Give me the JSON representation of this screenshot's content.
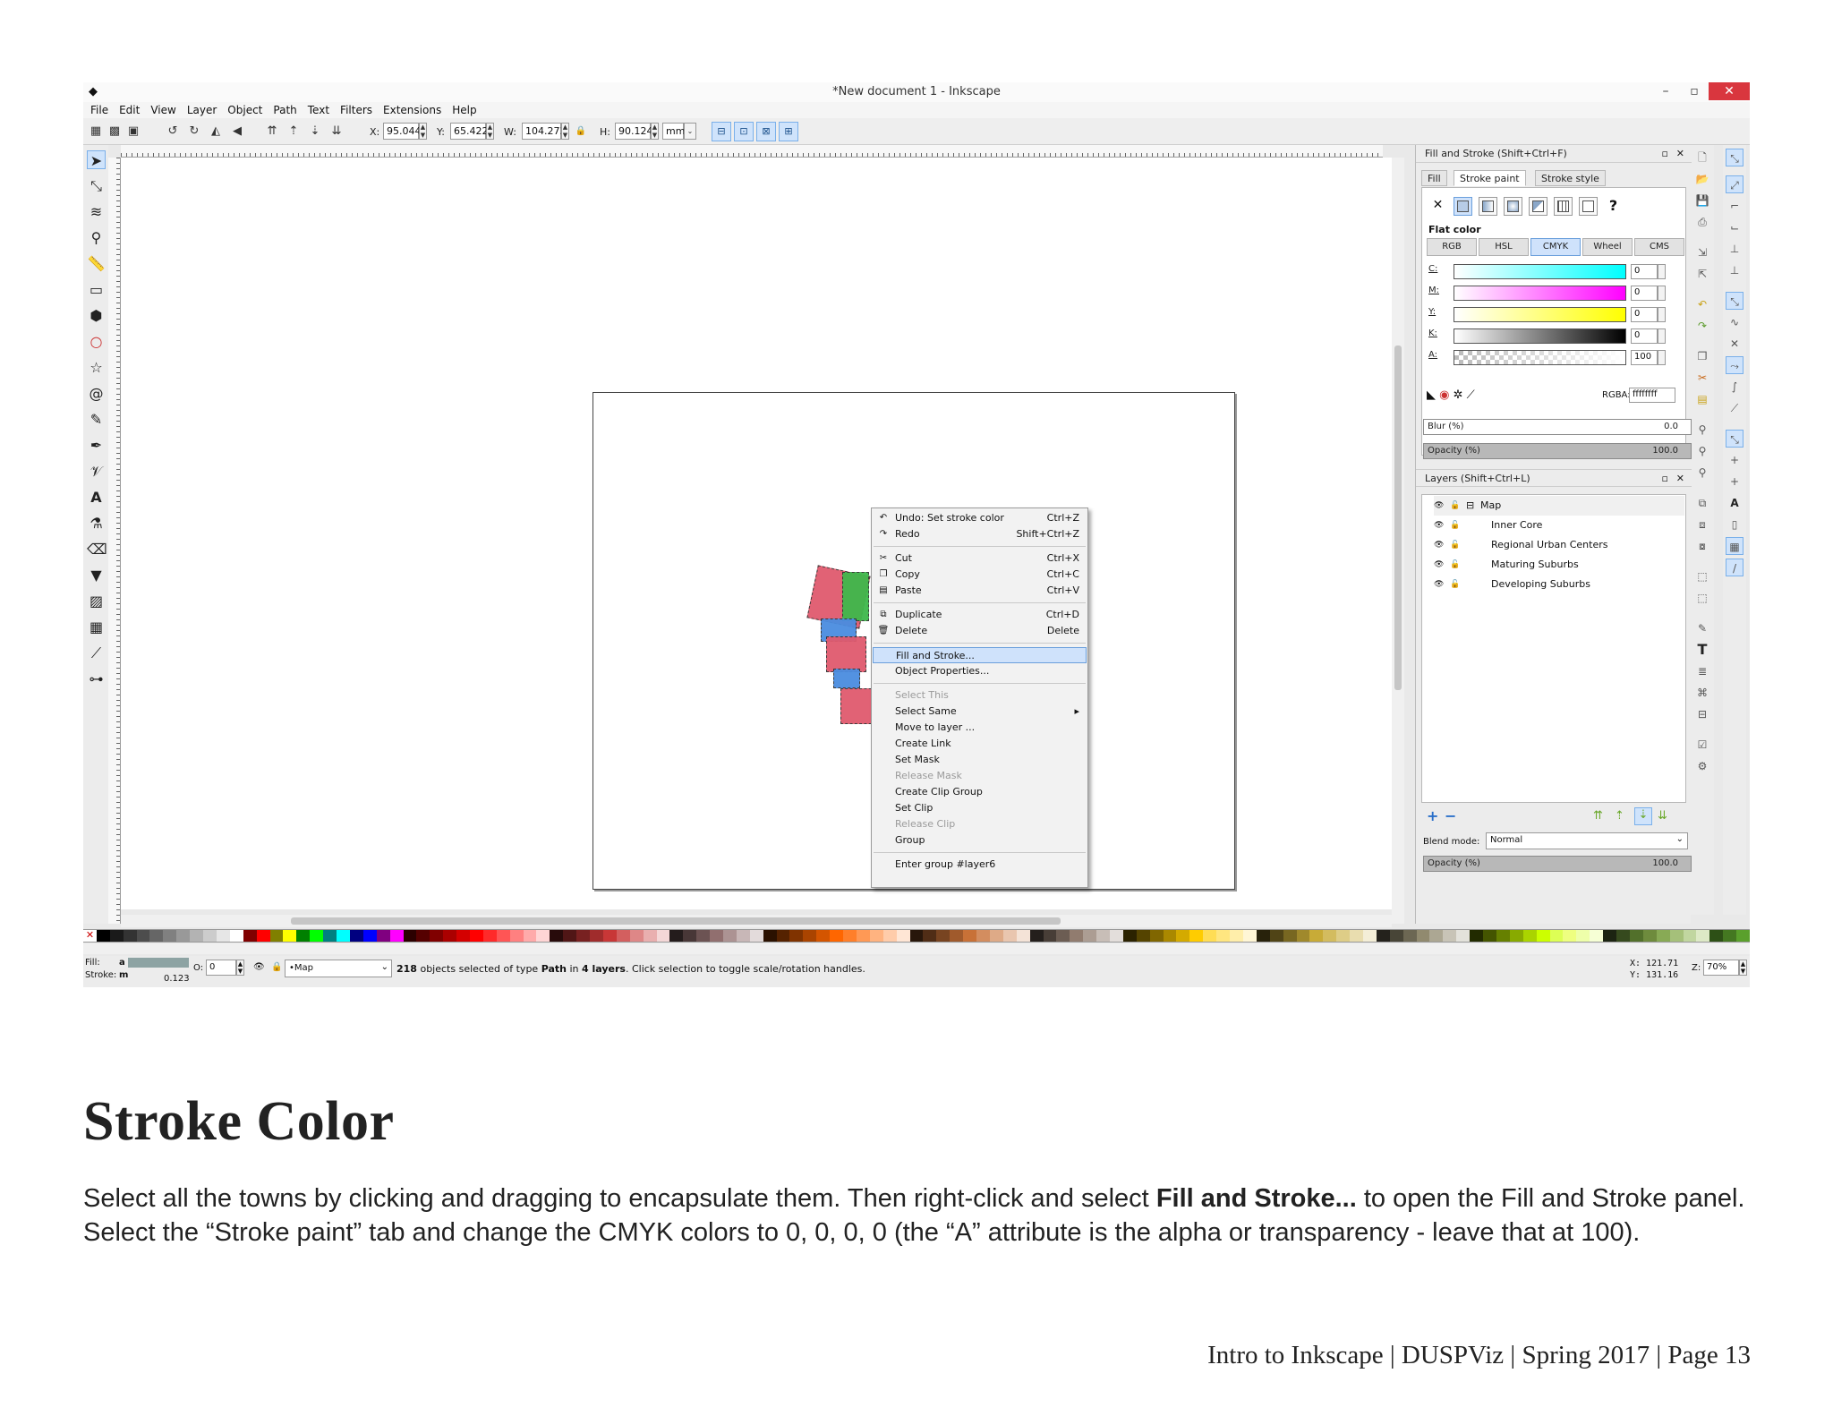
{
  "window": {
    "title": "*New document 1 - Inkscape",
    "minimize": "–",
    "restore": "▫",
    "close": "✕"
  },
  "menubar": [
    "File",
    "Edit",
    "View",
    "Layer",
    "Object",
    "Path",
    "Text",
    "Filters",
    "Extensions",
    "Help"
  ],
  "toolbar": {
    "x_label": "X:",
    "x_value": "95.044",
    "y_label": "Y:",
    "y_value": "65.422",
    "w_label": "W:",
    "w_value": "104.273",
    "h_label": "H:",
    "h_value": "90.124",
    "unit": "mm"
  },
  "context_menu": [
    {
      "label": "Undo: Set stroke color",
      "shortcut": "Ctrl+Z",
      "icon": "undo-icon",
      "glyph": "↶",
      "state": "normal"
    },
    {
      "label": "Redo",
      "shortcut": "Shift+Ctrl+Z",
      "icon": "redo-icon",
      "glyph": "↷",
      "state": "normal"
    },
    {
      "sep": true
    },
    {
      "label": "Cut",
      "shortcut": "Ctrl+X",
      "icon": "scissors-icon",
      "glyph": "✂",
      "state": "normal"
    },
    {
      "label": "Copy",
      "shortcut": "Ctrl+C",
      "icon": "copy-icon",
      "glyph": "❐",
      "state": "normal"
    },
    {
      "label": "Paste",
      "shortcut": "Ctrl+V",
      "icon": "paste-icon",
      "glyph": "▤",
      "state": "normal"
    },
    {
      "sep": true
    },
    {
      "label": "Duplicate",
      "shortcut": "Ctrl+D",
      "icon": "duplicate-icon",
      "glyph": "⧉",
      "state": "normal"
    },
    {
      "label": "Delete",
      "shortcut": "Delete",
      "icon": "trash-icon",
      "glyph": "🗑",
      "state": "normal"
    },
    {
      "sep": true
    },
    {
      "label": "Fill and Stroke...",
      "shortcut": "",
      "icon": "",
      "glyph": "",
      "state": "highlight"
    },
    {
      "label": "Object Properties...",
      "shortcut": "",
      "icon": "",
      "glyph": "",
      "state": "normal"
    },
    {
      "sep": true
    },
    {
      "label": "Select This",
      "shortcut": "",
      "icon": "",
      "glyph": "",
      "state": "disabled"
    },
    {
      "label": "Select Same",
      "shortcut": "▸",
      "icon": "",
      "glyph": "",
      "state": "normal"
    },
    {
      "label": "Move to layer ...",
      "shortcut": "",
      "icon": "",
      "glyph": "",
      "state": "normal"
    },
    {
      "label": "Create Link",
      "shortcut": "",
      "icon": "",
      "glyph": "",
      "state": "normal"
    },
    {
      "label": "Set Mask",
      "shortcut": "",
      "icon": "",
      "glyph": "",
      "state": "normal"
    },
    {
      "label": "Release Mask",
      "shortcut": "",
      "icon": "",
      "glyph": "",
      "state": "disabled"
    },
    {
      "label": "Create Clip Group",
      "shortcut": "",
      "icon": "",
      "glyph": "",
      "state": "normal"
    },
    {
      "label": "Set Clip",
      "shortcut": "",
      "icon": "",
      "glyph": "",
      "state": "normal"
    },
    {
      "label": "Release Clip",
      "shortcut": "",
      "icon": "",
      "glyph": "",
      "state": "disabled"
    },
    {
      "label": "Group",
      "shortcut": "",
      "icon": "",
      "glyph": "",
      "state": "normal"
    },
    {
      "sep": true
    },
    {
      "label": "Enter group #layer6",
      "shortcut": "",
      "icon": "",
      "glyph": "",
      "state": "normal"
    }
  ],
  "fill_stroke": {
    "title": "Fill and Stroke (Shift+Ctrl+F)",
    "tabs": [
      "Fill",
      "Stroke paint",
      "Stroke style"
    ],
    "paint_buttons": [
      "✕",
      "",
      "",
      "",
      "",
      "",
      "?"
    ],
    "flat_color": "Flat color",
    "modes": [
      "RGB",
      "HSL",
      "CMYK",
      "Wheel",
      "CMS"
    ],
    "sliders": [
      {
        "label": "C:",
        "value": "0",
        "gradient": "linear-gradient(90deg,#ffffff,#00ffff)"
      },
      {
        "label": "M:",
        "value": "0",
        "gradient": "linear-gradient(90deg,#ffffff,#ff00ff)"
      },
      {
        "label": "Y:",
        "value": "0",
        "gradient": "linear-gradient(90deg,#ffffff,#ffff00)"
      },
      {
        "label": "K:",
        "value": "0",
        "gradient": "linear-gradient(90deg,#ffffff,#000000)"
      },
      {
        "label": "A:",
        "value": "100",
        "gradient": "linear-gradient(90deg,rgba(255,255,255,0),#ffffff)"
      }
    ],
    "rgba_label": "RGBA:",
    "rgba_value": "ffffffff",
    "blur_label": "Blur (%)",
    "blur_value": "0.0",
    "opacity_label": "Opacity (%)",
    "opacity_value": "100.0"
  },
  "layers_panel": {
    "title": "Layers (Shift+Ctrl+L)",
    "layers": [
      {
        "name": "Map",
        "indent": "root"
      },
      {
        "name": "Inner Core",
        "indent": "child"
      },
      {
        "name": "Regional Urban Centers",
        "indent": "child"
      },
      {
        "name": "Maturing Suburbs",
        "indent": "child"
      },
      {
        "name": "Developing Suburbs",
        "indent": "child"
      }
    ],
    "blend_label": "Blend mode:",
    "blend_value": "Normal",
    "opacity_label": "Opacity (%)",
    "opacity_value": "100.0"
  },
  "status": {
    "fill_label": "Fill:",
    "fill_value": "a",
    "stroke_label": "Stroke:",
    "stroke_value": "m",
    "stroke_width": "0.123",
    "o_label": "O:",
    "o_value": "0",
    "layer_value": "•Map",
    "message_count": "218",
    "message_a": " objects selected of type ",
    "message_type": "Path",
    "message_b": " in ",
    "message_layers": "4 layers",
    "message_c": ". Click selection to toggle scale/rotation handles.",
    "x_readout": "X: 121.71",
    "y_readout": "Y: 131.16",
    "zoom_label": "Z:",
    "zoom_value": "70%"
  },
  "palette_colors": [
    "#000000",
    "#1a1a1a",
    "#333333",
    "#4d4d4d",
    "#666666",
    "#808080",
    "#999999",
    "#b3b3b3",
    "#cccccc",
    "#e6e6e6",
    "#ffffff",
    "#800000",
    "#ff0000",
    "#808000",
    "#ffff00",
    "#008000",
    "#00ff00",
    "#008080",
    "#00ffff",
    "#000080",
    "#0000ff",
    "#800080",
    "#ff00ff",
    "#2b0000",
    "#550000",
    "#800000",
    "#aa0000",
    "#d40000",
    "#ff0000",
    "#ff2a2a",
    "#ff5555",
    "#ff8080",
    "#ffaaaa",
    "#ffd5d5",
    "#280b0b",
    "#501616",
    "#782121",
    "#a02c2c",
    "#c83737",
    "#d35f5f",
    "#de8787",
    "#e9afaf",
    "#f4d7d7",
    "#241c1c",
    "#483737",
    "#6c5353",
    "#916f6f",
    "#ac9393",
    "#c8b7b7",
    "#e3dbdb",
    "#2b1100",
    "#552200",
    "#803300",
    "#aa4400",
    "#d45500",
    "#ff6600",
    "#ff7f2a",
    "#ff9955",
    "#ffb380",
    "#ffccaa",
    "#ffe6d5",
    "#28170b",
    "#502d16",
    "#784421",
    "#a05a2c",
    "#c87137",
    "#d38d5f",
    "#deaa87",
    "#e9c6af",
    "#f4e3d7",
    "#241f1c",
    "#483e37",
    "#6c5d53",
    "#917c6f",
    "#ac9d93",
    "#c8beb7",
    "#e3dedb",
    "#2b2200",
    "#554400",
    "#806600",
    "#aa8800",
    "#d4aa00",
    "#ffcc00",
    "#ffdd55",
    "#ffe680",
    "#ffeeaa",
    "#fff6d5",
    "#28220b",
    "#504416",
    "#786721",
    "#a0892c",
    "#c8ab37",
    "#d3bc5f",
    "#decd87",
    "#e9ddaf",
    "#f4eed7",
    "#24221c",
    "#484537",
    "#6c6753",
    "#918a6f",
    "#aca793",
    "#c8c4b7",
    "#e3e2db",
    "#222b00",
    "#445500",
    "#668000",
    "#88aa00",
    "#aad400",
    "#ccff00",
    "#ddff55",
    "#eeff80",
    "#eeffaa",
    "#f6ffd5",
    "#1c2412",
    "#364a1e",
    "#52702b",
    "#6e8b3d",
    "#88aa55",
    "#a5c07a",
    "#c1d6a0",
    "#dde9c6",
    "#2d5016",
    "#447821",
    "#5aa02c"
  ],
  "document": {
    "heading": "Stroke Color",
    "para_a": "Select all the towns by clicking and dragging to encapsulate them. Then right-click and select ",
    "para_bold": "Fill and Stroke...",
    "para_b": " to open the Fill and Stroke panel. Select the “Stroke paint” tab and change the CMYK colors to 0, 0, 0, 0 (the “A” attribute is the alpha or transparency - leave that at 100).",
    "footer": "Intro to Inkscape | DUSPViz | Spring 2017 | Page 13"
  }
}
